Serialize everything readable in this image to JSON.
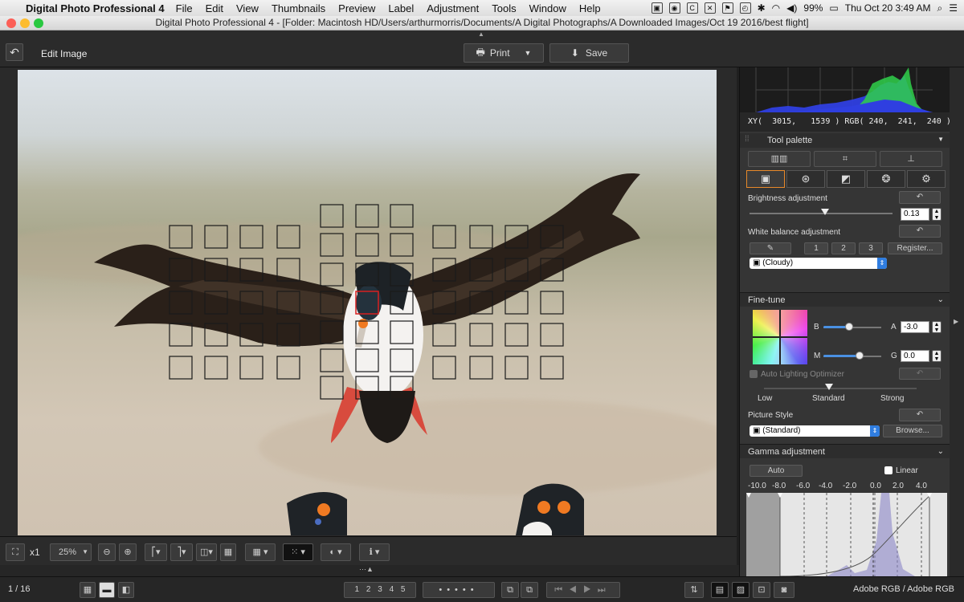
{
  "menubar": {
    "app_name": "Digital Photo Professional 4",
    "menus": [
      "File",
      "Edit",
      "View",
      "Thumbnails",
      "Preview",
      "Label",
      "Adjustment",
      "Tools",
      "Window",
      "Help"
    ],
    "battery": "99%",
    "clock": "Thu Oct 20  3:49 AM"
  },
  "window": {
    "title": "Digital Photo Professional 4 - [Folder: Macintosh HD/Users/arthurmorris/Documents/A Digital Photographs/A Downloaded Images/Oct 19 2016/best flight]"
  },
  "toolbar": {
    "mode_label": "Edit Image",
    "print_label": "Print",
    "save_label": "Save"
  },
  "status": {
    "zoom_prefix": "x1",
    "zoom": "25%",
    "page_counter": "1 / 16",
    "color_space": "Adobe RGB / Adobe RGB"
  },
  "histogram": {
    "readout": "XY(  3015,   1539 ) RGB( 240,  241,  240 )"
  },
  "tool_palette": {
    "title": "Tool palette",
    "brightness": {
      "label": "Brightness adjustment",
      "value": "0.13",
      "slider_fraction": 0.53
    },
    "white_balance": {
      "label": "White balance adjustment",
      "presets": [
        "1",
        "2",
        "3"
      ],
      "register_label": "Register...",
      "selected": "(Cloudy)"
    },
    "fine_tune": {
      "label": "Fine-tune",
      "b_label": "B",
      "a_label": "A",
      "a_value": "-3.0",
      "m_label": "M",
      "g_label": "G",
      "g_value": "0.0",
      "b_fraction": 0.45,
      "m_fraction": 0.62
    },
    "alo": {
      "label": "Auto Lighting Optimizer",
      "low": "Low",
      "standard": "Standard",
      "strong": "Strong"
    },
    "picture_style": {
      "label": "Picture Style",
      "selected": "(Standard)",
      "browse_label": "Browse..."
    },
    "gamma": {
      "label": "Gamma adjustment",
      "auto_label": "Auto",
      "linear_label": "Linear",
      "ticks": [
        "-10.0",
        "-8.0",
        "-6.0",
        "-4.0",
        "-2.0",
        "0.0",
        "2.0",
        "4.0"
      ]
    }
  },
  "filmstrip": {
    "rating_labels": [
      "1",
      "2",
      "3",
      "4",
      "5"
    ]
  },
  "colors": {
    "accent": "#2f7de0",
    "active_tab": "#e8892a",
    "af_selected": "#d62020"
  }
}
